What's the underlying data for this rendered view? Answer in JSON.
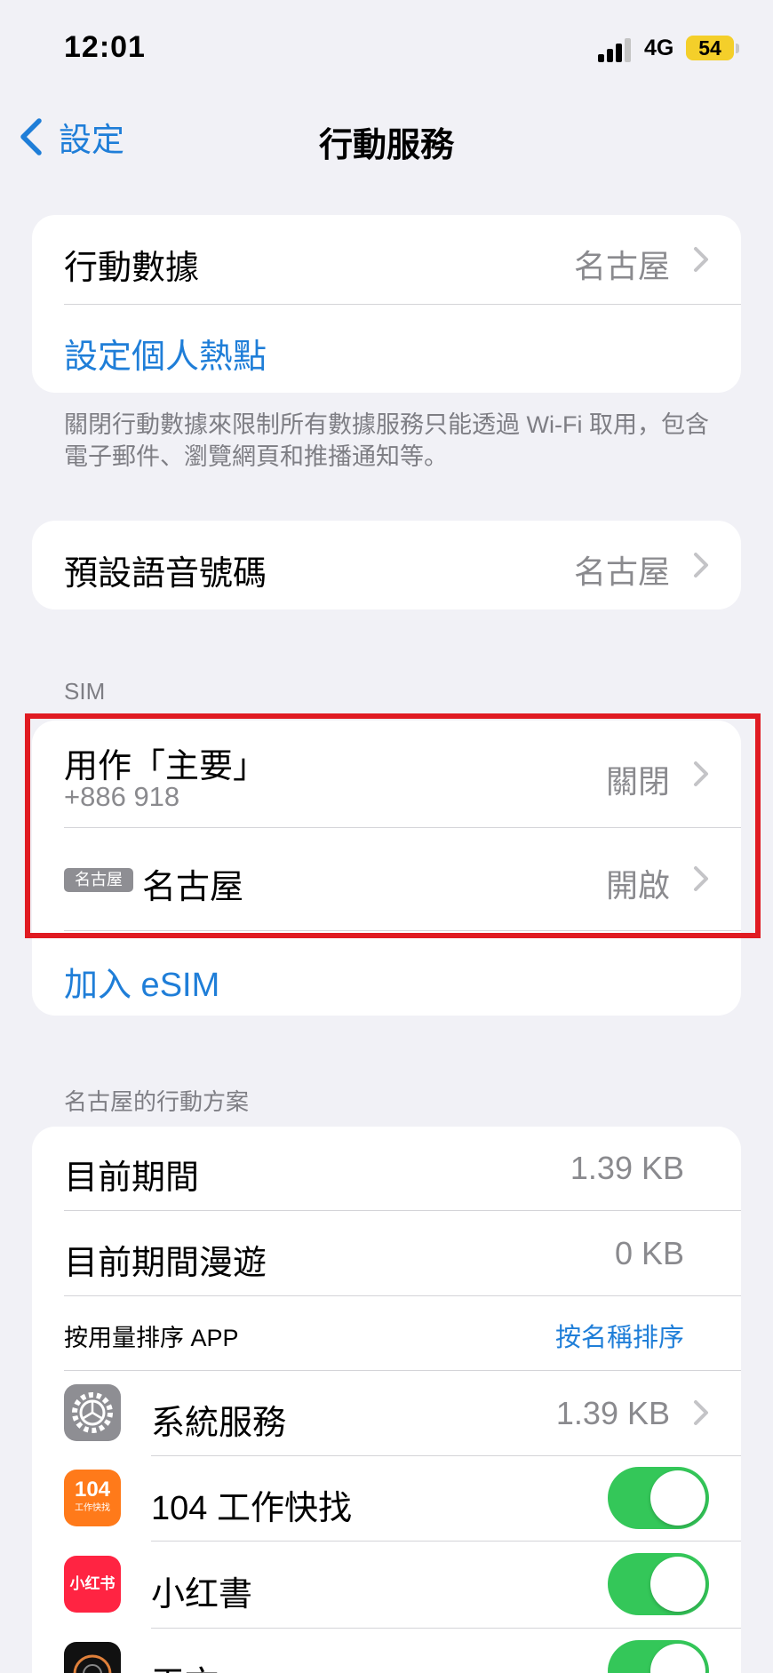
{
  "status_bar": {
    "time": "12:01",
    "network": "4G",
    "battery": "54",
    "battery_color": "#f4cf2a"
  },
  "nav": {
    "back_label": "設定",
    "title": "行動服務"
  },
  "data_card": {
    "cellular_data_label": "行動數據",
    "cellular_data_value": "名古屋",
    "hotspot_label": "設定個人熱點"
  },
  "data_footnote": "關閉行動數據來限制所有數據服務只能透過 Wi-Fi 取用，包含電子郵件、瀏覽網頁和推播通知等。",
  "voice_card": {
    "label": "預設語音號碼",
    "value": "名古屋"
  },
  "sim_section": {
    "header": "SIM",
    "primary_label": "用作「主要」",
    "primary_number": "+886 918",
    "primary_value": "關閉",
    "second_badge": "名古屋",
    "second_label": "名古屋",
    "second_value": "開啟",
    "add_esim_label": "加入 eSIM"
  },
  "plan_section": {
    "header": "名古屋的行動方案",
    "current_period_label": "目前期間",
    "current_period_value": "1.39 KB",
    "roaming_label": "目前期間漫遊",
    "roaming_value": "0 KB",
    "sort_label": "按用量排序 APP",
    "sort_by_name": "按名稱排序",
    "apps": [
      {
        "name": "系統服務",
        "value": "1.39 KB",
        "icon": "gear-icon"
      },
      {
        "name": "104 工作快找",
        "icon": "104-app-icon",
        "enabled": true,
        "icon_text": "104",
        "icon_subtext": "工作快找"
      },
      {
        "name": "小红書",
        "icon": "xiaohongshu-icon",
        "enabled": true,
        "icon_text": "小红书"
      },
      {
        "name": "天文",
        "icon": "astronomy-app-icon",
        "enabled": true
      }
    ]
  },
  "colors": {
    "accent": "#1f7ed8",
    "toggle_on": "#34c759",
    "highlight": "#e01b22"
  }
}
